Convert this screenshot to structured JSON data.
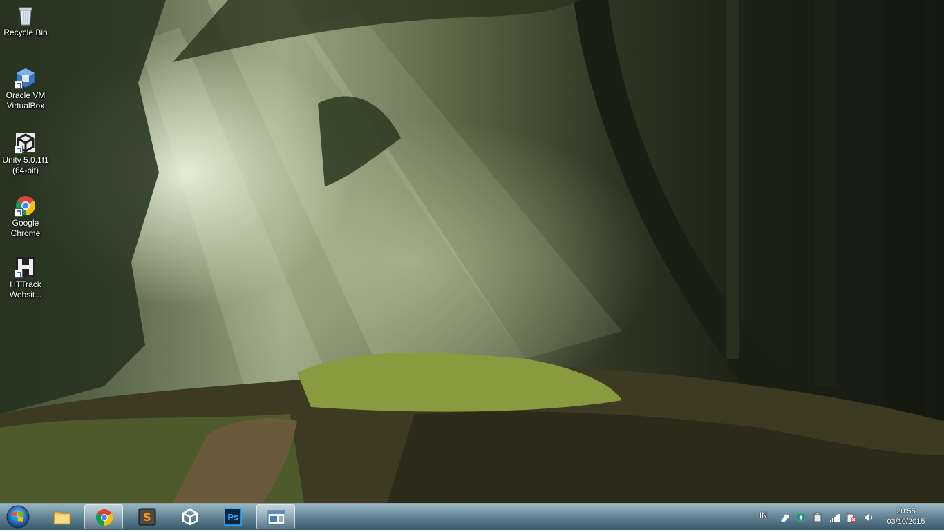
{
  "desktop": {
    "icons": [
      {
        "label": "Recycle Bin",
        "icon": "recycle-bin-icon"
      },
      {
        "label": "Oracle VM VirtualBox",
        "icon": "virtualbox-icon"
      },
      {
        "label": "Unity 5.0.1f1 (64-bit)",
        "icon": "unity-icon"
      },
      {
        "label": "Google Chrome",
        "icon": "chrome-icon"
      },
      {
        "label": "HTTrack Websit...",
        "icon": "httrack-icon"
      }
    ]
  },
  "taskbar": {
    "start": {
      "icon": "windows-start-icon"
    },
    "pinned": [
      {
        "name": "Windows Explorer",
        "icon": "folder-icon",
        "active": false
      },
      {
        "name": "Google Chrome",
        "icon": "chrome-icon",
        "active": true
      },
      {
        "name": "Sublime Text",
        "icon": "sublime-icon",
        "active": false
      },
      {
        "name": "Unity",
        "icon": "unity-icon",
        "active": false
      },
      {
        "name": "Photoshop",
        "icon": "photoshop-icon",
        "active": false
      },
      {
        "name": "Window",
        "icon": "window-icon",
        "active": true
      }
    ],
    "tray": {
      "language": "IN",
      "icons": [
        "flag-icon",
        "network-sharing-icon",
        "device-icon",
        "signal-icon",
        "battery-alert-icon",
        "volume-icon"
      ],
      "time": "20:55",
      "date": "03/10/2015"
    }
  }
}
